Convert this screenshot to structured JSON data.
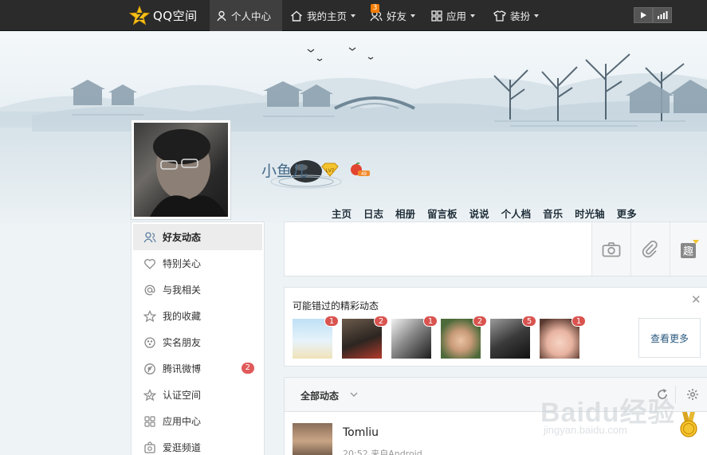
{
  "topbar": {
    "logo_text": "QQ空间",
    "items": [
      {
        "label": "个人中心"
      },
      {
        "label": "我的主页"
      },
      {
        "label": "好友",
        "badge": "3"
      },
      {
        "label": "应用"
      },
      {
        "label": "装扮"
      }
    ]
  },
  "profile": {
    "username": "小鱼儿",
    "vip_level": "LV7",
    "fruit_count": "49",
    "nav": [
      "主页",
      "日志",
      "相册",
      "留言板",
      "说说",
      "个人档",
      "音乐",
      "时光轴",
      "更多"
    ]
  },
  "sidebar": {
    "items": [
      {
        "label": "好友动态",
        "icon": "friends-icon"
      },
      {
        "label": "特别关心",
        "icon": "heart-icon"
      },
      {
        "label": "与我相关",
        "icon": "at-icon"
      },
      {
        "label": "我的收藏",
        "icon": "star-icon"
      },
      {
        "label": "实名朋友",
        "icon": "flower-icon"
      },
      {
        "label": "腾讯微博",
        "icon": "weibo-icon",
        "count": "2"
      },
      {
        "label": "认证空间",
        "icon": "certified-star-icon"
      },
      {
        "label": "应用中心",
        "icon": "apps-grid-icon"
      },
      {
        "label": "爱逛频道",
        "icon": "bag-icon"
      }
    ]
  },
  "composer": {
    "tools": [
      "camera-icon",
      "attachment-icon",
      "fun-icon"
    ],
    "fun_label": "趣"
  },
  "missed": {
    "title": "可能错过的精彩动态",
    "counts": [
      "1",
      "2",
      "1",
      "2",
      "5",
      "1"
    ],
    "more_label": "查看更多"
  },
  "feed_filter": {
    "label": "全部动态"
  },
  "feed": {
    "name": "Tomliu",
    "meta": "20:52 来自Android"
  },
  "watermark": {
    "text": "Baidu经验",
    "sub": "jingyan.baidu.com"
  },
  "colors": {
    "topbar": "#2b2b2b",
    "accent_blue": "#456a88",
    "badge_red": "#e05a5a",
    "badge_orange": "#f57c00"
  }
}
